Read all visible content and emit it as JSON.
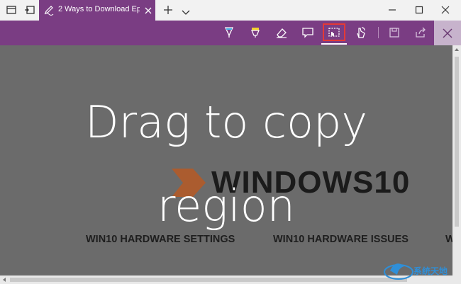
{
  "tab": {
    "title": "2 Ways to Download Ep"
  },
  "icons": {
    "tab_manager": "tab-manager-icon",
    "set_aside": "set-aside-tabs-icon",
    "web_note": "pen-icon",
    "close_tab": "close-icon",
    "new_tab": "plus-icon",
    "tab_menu": "chevron-down-icon",
    "minimize": "minimize-icon",
    "maximize": "maximize-icon",
    "close_window": "close-icon"
  },
  "toolbar": {
    "tools": [
      "pen-icon",
      "highlighter-icon",
      "eraser-icon",
      "comment-icon",
      "clip-icon",
      "touch-write-icon",
      "save-icon",
      "share-icon"
    ],
    "selected_tool": "clip-icon",
    "exit": "close-icon"
  },
  "page": {
    "brand_text": "WINDOWS10",
    "nav": [
      "WIN10 HARDWARE SETTINGS",
      "WIN10 HARDWARE ISSUES",
      "W"
    ]
  },
  "overlay": {
    "line1": "Drag to copy",
    "line2": "region"
  },
  "watermark": {
    "text": "系统天地"
  },
  "colors": {
    "accent": "#7a3d83",
    "highlight": "#e53935",
    "overlay_bg": "#6b6b6b",
    "brand_orange": "#c0571b"
  }
}
